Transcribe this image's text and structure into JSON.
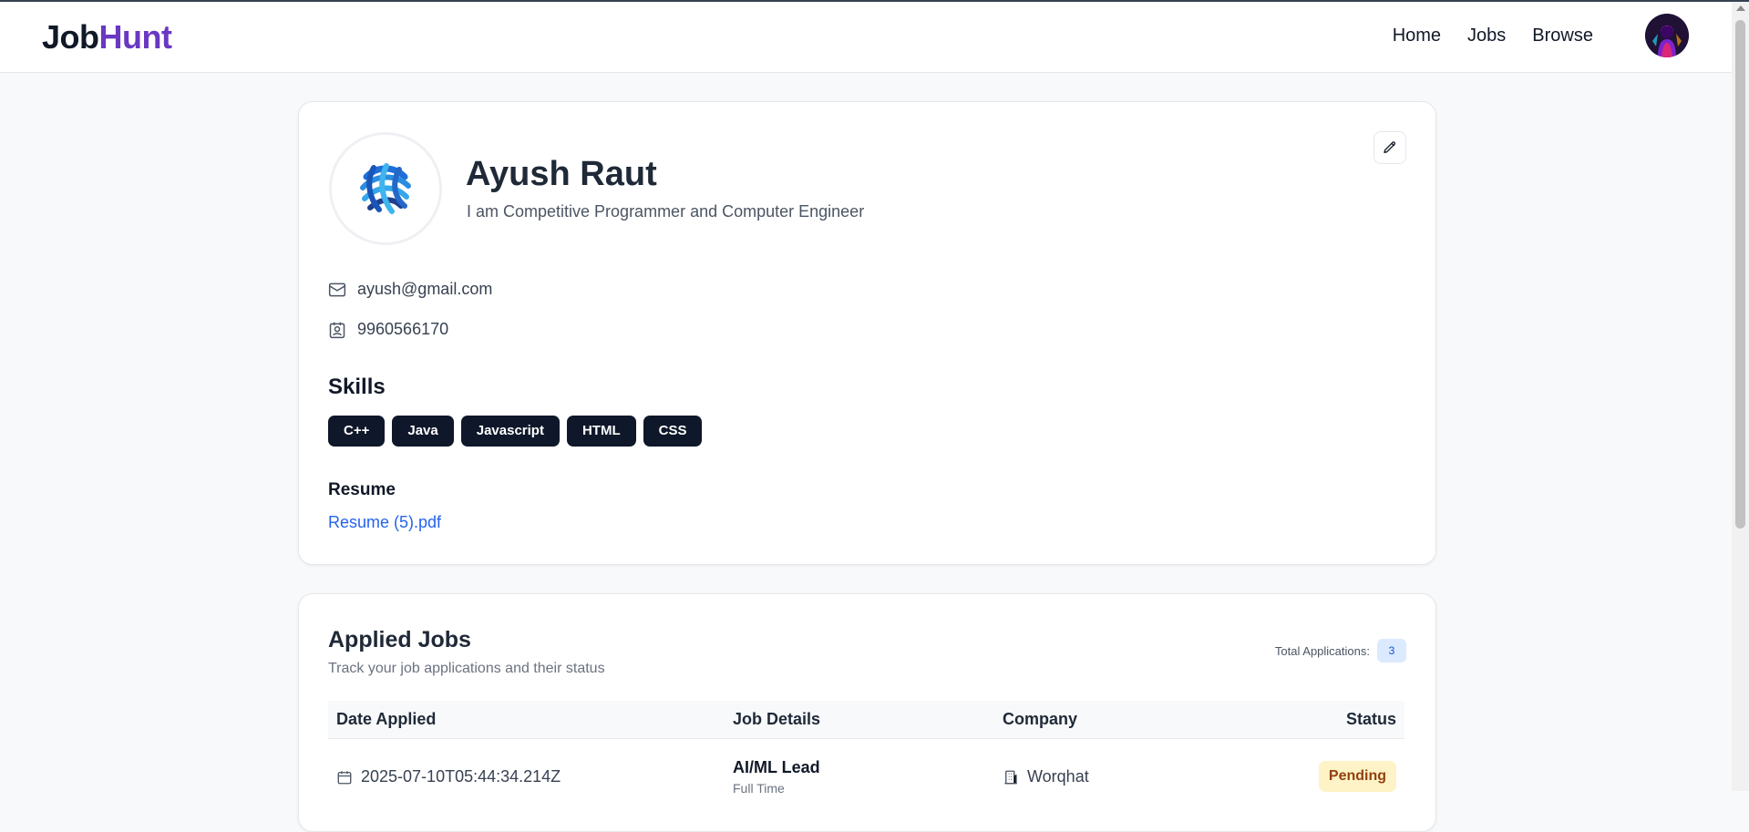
{
  "app": {
    "logo_part1": "Job",
    "logo_part2": "Hunt",
    "brand_color": "#6a38c2"
  },
  "nav": {
    "items": [
      {
        "label": "Home"
      },
      {
        "label": "Jobs"
      },
      {
        "label": "Browse"
      }
    ],
    "avatar_icon": "user-avatar"
  },
  "profile": {
    "name": "Ayush Raut",
    "bio": "I am Competitive Programmer and Computer Engineer",
    "email": "ayush@gmail.com",
    "phone": "9960566170",
    "skills_title": "Skills",
    "skills": [
      "C++",
      "Java",
      "Javascript",
      "HTML",
      "CSS"
    ],
    "resume_label": "Resume",
    "resume_file": "Resume (5).pdf",
    "icons": {
      "edit": "pencil-icon",
      "email": "mail-icon",
      "phone": "contact-card-icon",
      "logo": "company-logo"
    }
  },
  "applied_jobs": {
    "title": "Applied Jobs",
    "subtitle": "Track your job applications and their status",
    "total_label": "Total Applications:",
    "total_count": "3",
    "columns": {
      "date": "Date Applied",
      "job": "Job Details",
      "company": "Company",
      "status": "Status"
    },
    "rows": [
      {
        "date": "2025-07-10T05:44:34.214Z",
        "job_title": "AI/ML Lead",
        "job_type": "Full Time",
        "company": "Worqhat",
        "status": "Pending"
      }
    ],
    "status_colors": {
      "pending_bg": "#fef3c7",
      "pending_text": "#92400e"
    }
  }
}
